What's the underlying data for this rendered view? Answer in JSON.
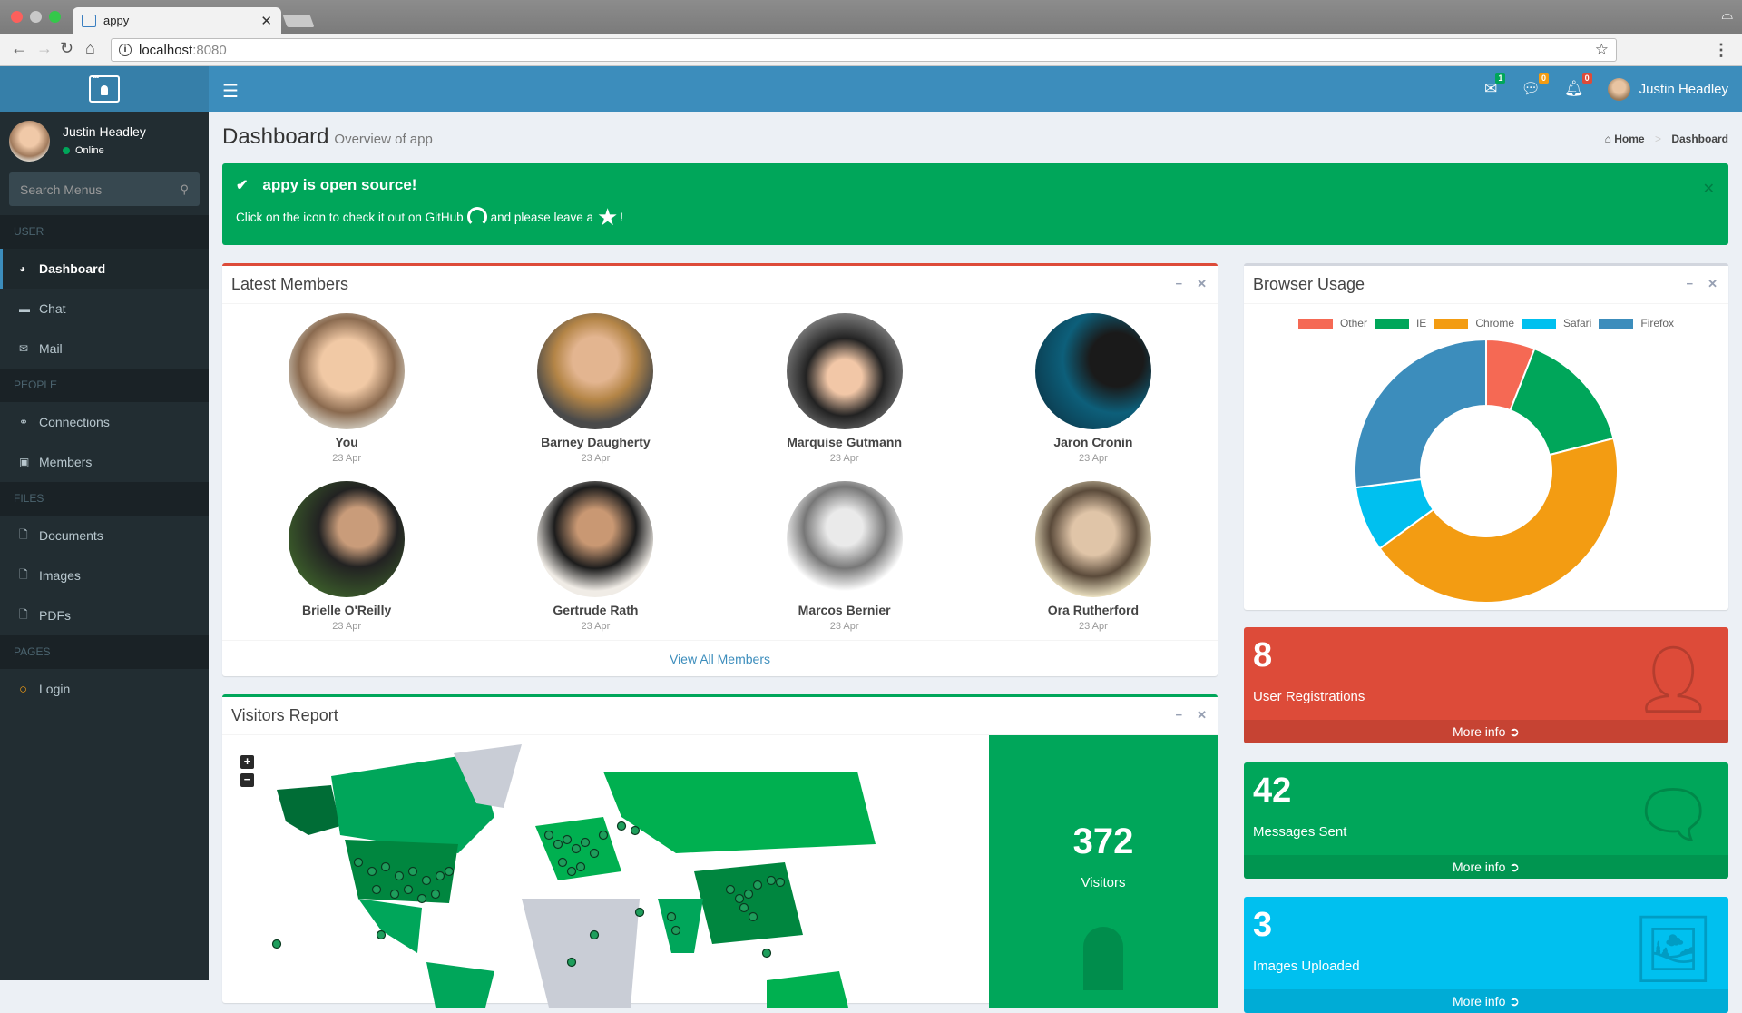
{
  "browser": {
    "tab_title": "appy",
    "url_host": "localhost",
    "url_port": ":8080"
  },
  "header": {
    "menu_icon": "hamburger-icon",
    "notifications": [
      {
        "icon": "envelope-icon",
        "count": "1",
        "color": "#00a65a"
      },
      {
        "icon": "comments-icon",
        "count": "0",
        "color": "#f39c12"
      },
      {
        "icon": "bell-icon",
        "count": "0",
        "color": "#dd4b39"
      }
    ],
    "user_name": "Justin Headley"
  },
  "sidebar": {
    "user_name": "Justin Headley",
    "status": "Online",
    "search_placeholder": "Search Menus",
    "sections": [
      {
        "header": "USER",
        "items": [
          {
            "label": "Dashboard",
            "icon": "dashboard-icon",
            "active": true
          },
          {
            "label": "Chat",
            "icon": "chat-icon"
          },
          {
            "label": "Mail",
            "icon": "envelope-icon"
          }
        ]
      },
      {
        "header": "PEOPLE",
        "items": [
          {
            "label": "Connections",
            "icon": "handshake-icon"
          },
          {
            "label": "Members",
            "icon": "address-book-icon"
          }
        ]
      },
      {
        "header": "FILES",
        "items": [
          {
            "label": "Documents",
            "icon": "word-file-icon"
          },
          {
            "label": "Images",
            "icon": "image-file-icon"
          },
          {
            "label": "PDFs",
            "icon": "pdf-file-icon"
          }
        ]
      },
      {
        "header": "PAGES",
        "items": [
          {
            "label": "Login",
            "icon": "circle-icon"
          }
        ]
      }
    ]
  },
  "page": {
    "title": "Dashboard",
    "subtitle": "Overview of app",
    "breadcrumb": [
      "Home",
      "Dashboard"
    ]
  },
  "alert": {
    "title": "appy is open source!",
    "text_before": "Click on the icon to check it out on GitHub",
    "text_middle": "and please leave a",
    "text_after": "!"
  },
  "members_box": {
    "title": "Latest Members",
    "footer_link": "View All Members",
    "members": [
      {
        "name": "You",
        "date": "23 Apr"
      },
      {
        "name": "Barney Daugherty",
        "date": "23 Apr"
      },
      {
        "name": "Marquise Gutmann",
        "date": "23 Apr"
      },
      {
        "name": "Jaron Cronin",
        "date": "23 Apr"
      },
      {
        "name": "Brielle O'Reilly",
        "date": "23 Apr"
      },
      {
        "name": "Gertrude Rath",
        "date": "23 Apr"
      },
      {
        "name": "Marcos Bernier",
        "date": "23 Apr"
      },
      {
        "name": "Ora Rutherford",
        "date": "23 Apr"
      }
    ]
  },
  "browser_usage": {
    "title": "Browser Usage"
  },
  "chart_data": {
    "type": "pie",
    "title": "Browser Usage",
    "donut": true,
    "legend_position": "top",
    "categories": [
      "Other",
      "IE",
      "Chrome",
      "Safari",
      "Firefox"
    ],
    "values": [
      6,
      15,
      44,
      8,
      27
    ],
    "colors": [
      "#f56954",
      "#00a65a",
      "#f39c12",
      "#00c0ef",
      "#3c8dbc"
    ]
  },
  "info_boxes": [
    {
      "value": "8",
      "label": "User Registrations",
      "footer": "More info",
      "icon": "user-plus-icon",
      "color": "#dd4b39"
    },
    {
      "value": "42",
      "label": "Messages Sent",
      "footer": "More info",
      "icon": "comments-icon",
      "color": "#00a65a"
    },
    {
      "value": "3",
      "label": "Images Uploaded",
      "footer": "More info",
      "icon": "images-icon",
      "color": "#00c0ef"
    }
  ],
  "visitors": {
    "title": "Visitors Report",
    "count": "372",
    "label": "Visitors",
    "zoom_in": "+",
    "zoom_out": "−"
  }
}
